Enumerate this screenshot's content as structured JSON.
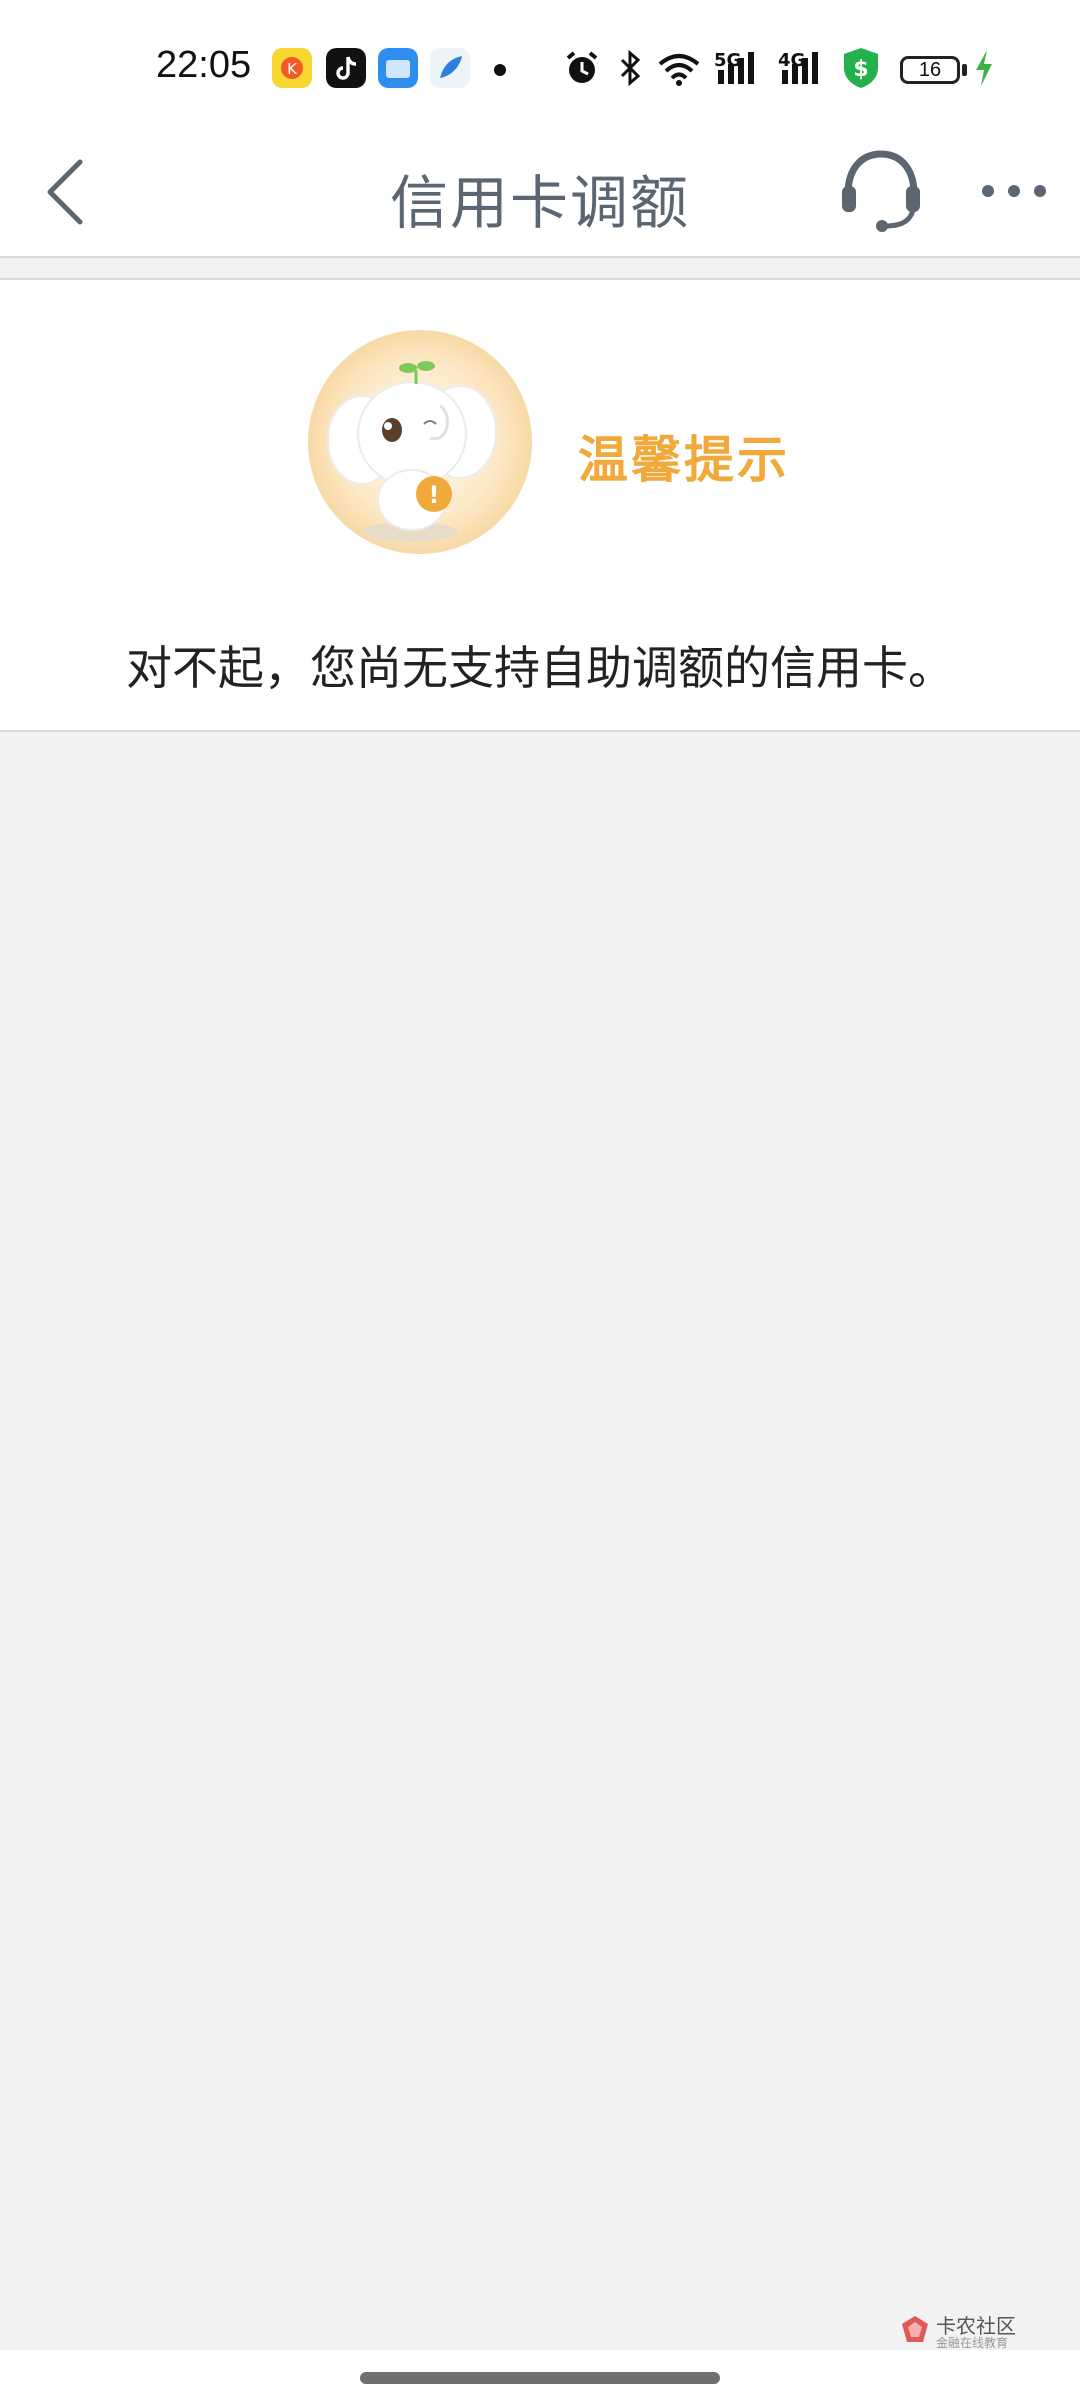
{
  "status_bar": {
    "time": "22:05",
    "icons": [
      "kuaishou-app-icon",
      "tiktok-app-icon",
      "files-app-icon",
      "feather-app-icon",
      "notification-dot",
      "alarm-icon",
      "bluetooth-icon",
      "wifi-icon",
      "signal-5g-icon",
      "signal-4g-icon",
      "security-shield-icon",
      "battery-icon",
      "charging-icon"
    ],
    "net_5g": "5G",
    "net_4g": "4G",
    "battery_level": "16"
  },
  "nav": {
    "title": "信用卡调额",
    "icons": [
      "back-chevron-icon",
      "customer-service-headset-icon",
      "more-dots-icon"
    ]
  },
  "notice": {
    "title": "温馨提示",
    "message": "对不起，您尚无支持自助调额的信用卡。"
  },
  "watermark": {
    "text": "卡农社区",
    "subtext": "金融在线教育"
  },
  "colors": {
    "accent": "#f0a93a",
    "title": "#5a6672",
    "background": "#f2f2f2",
    "shield": "#22b14c"
  }
}
